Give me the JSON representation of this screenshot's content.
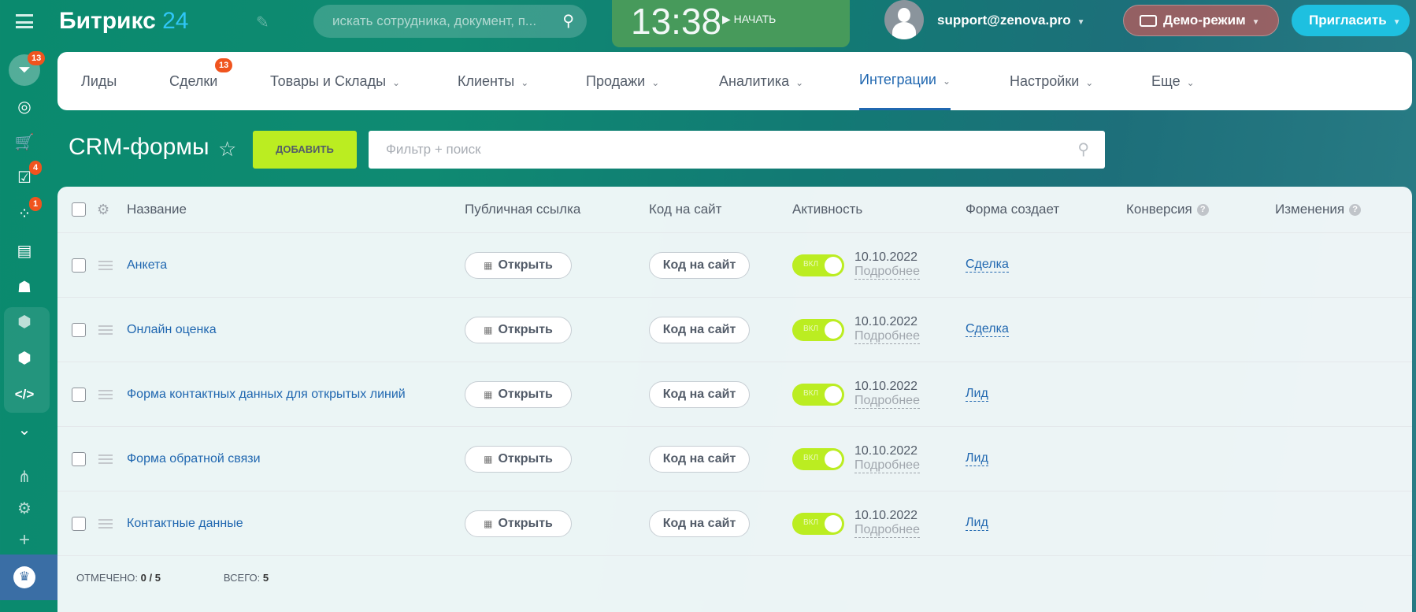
{
  "sidebar": {
    "badges": {
      "funnel": "13",
      "tasks": "4",
      "dots": "1"
    }
  },
  "header": {
    "logo_main": "Битрикс",
    "logo_num": "24",
    "search_placeholder": "искать сотрудника, документ, п...",
    "clock": "13:38",
    "start_label": "НАЧАТЬ",
    "user": "support@zenova.pro",
    "demo_label": "Демо-режим",
    "invite_label": "Пригласить"
  },
  "nav": {
    "items": [
      {
        "label": "Лиды"
      },
      {
        "label": "Сделки",
        "badge": "13"
      },
      {
        "label": "Товары и Склады"
      },
      {
        "label": "Клиенты"
      },
      {
        "label": "Продажи"
      },
      {
        "label": "Аналитика"
      },
      {
        "label": "Интеграции"
      },
      {
        "label": "Настройки"
      },
      {
        "label": "Еще"
      }
    ]
  },
  "page": {
    "title": "CRM-формы",
    "add_label": "ДОБАВИТЬ",
    "filter_placeholder": "Фильтр + поиск"
  },
  "table": {
    "columns": [
      "Название",
      "Публичная ссылка",
      "Код на сайт",
      "Активность",
      "Форма создает",
      "Конверсия",
      "Изменения"
    ],
    "rows": [
      {
        "name": "Анкета",
        "open": "Открыть",
        "code": "Код на сайт",
        "toggle": "ВКЛ",
        "date": "10.10.2022",
        "more": "Подробнее",
        "creates": "Сделка"
      },
      {
        "name": "Онлайн оценка",
        "open": "Открыть",
        "code": "Код на сайт",
        "toggle": "ВКЛ",
        "date": "10.10.2022",
        "more": "Подробнее",
        "creates": "Сделка"
      },
      {
        "name": "Форма контактных данных для открытых линий",
        "open": "Открыть",
        "code": "Код на сайт",
        "toggle": "ВКЛ",
        "date": "10.10.2022",
        "more": "Подробнее",
        "creates": "Лид"
      },
      {
        "name": "Форма обратной связи",
        "open": "Открыть",
        "code": "Код на сайт",
        "toggle": "ВКЛ",
        "date": "10.10.2022",
        "more": "Подробнее",
        "creates": "Лид"
      },
      {
        "name": "Контактные данные",
        "open": "Открыть",
        "code": "Код на сайт",
        "toggle": "ВКЛ",
        "date": "10.10.2022",
        "more": "Подробнее",
        "creates": "Лид"
      }
    ],
    "footer": {
      "selected_label": "ОТМЕЧЕНО:",
      "selected_value": "0 / 5",
      "total_label": "ВСЕГО:",
      "total_value": "5"
    }
  }
}
